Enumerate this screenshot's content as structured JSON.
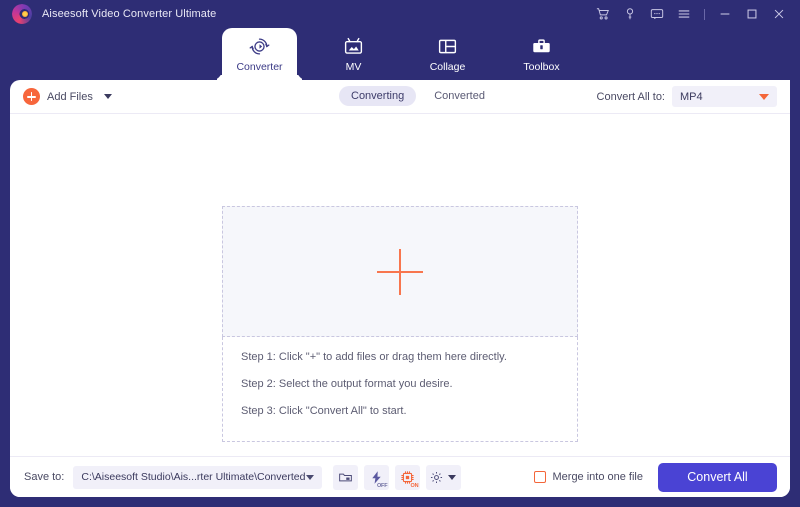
{
  "window": {
    "title": "Aiseesoft Video Converter Ultimate",
    "logo_icon": "aiseesoft-logo-icon",
    "controls": [
      {
        "name": "cart-icon",
        "label": "Cart"
      },
      {
        "name": "key-icon",
        "label": "Register"
      },
      {
        "name": "feedback-icon",
        "label": "Feedback"
      },
      {
        "name": "menu-icon",
        "label": "Menu"
      },
      {
        "name": "minimize-icon",
        "label": "Minimize"
      },
      {
        "name": "maximize-icon",
        "label": "Maximize"
      },
      {
        "name": "close-icon",
        "label": "Close"
      }
    ],
    "accent_header": "#2e2d75",
    "accent_button": "#4a43d4",
    "accent_orange": "#f4663a"
  },
  "tabs": [
    {
      "label": "Converter",
      "icon": "converter-icon",
      "active": true
    },
    {
      "label": "MV",
      "icon": "mv-icon",
      "active": false
    },
    {
      "label": "Collage",
      "icon": "collage-icon",
      "active": false
    },
    {
      "label": "Toolbox",
      "icon": "toolbox-icon",
      "active": false
    }
  ],
  "toolbar": {
    "add_files_label": "Add Files",
    "add_files_icon": "plus-circle-icon",
    "add_files_caret": "chevron-down-icon",
    "segments": [
      {
        "label": "Converting",
        "selected": true
      },
      {
        "label": "Converted",
        "selected": false
      }
    ],
    "convert_all_to_label": "Convert All to:",
    "format_value": "MP4",
    "format_caret": "caret-down-icon"
  },
  "dropzone": {
    "plus_icon": "plus-icon",
    "steps": [
      "Step 1: Click \"+\" to add files or drag them here directly.",
      "Step 2: Select the output format you desire.",
      "Step 3: Click \"Convert All\" to start."
    ]
  },
  "footer": {
    "save_to_label": "Save to:",
    "save_path": "C:\\Aiseesoft Studio\\Ais...rter Ultimate\\Converted",
    "path_caret": "caret-down-icon",
    "utilities": [
      {
        "name": "open-folder-icon",
        "tag": ""
      },
      {
        "name": "hardware-acceleration-icon",
        "tag": "OFF"
      },
      {
        "name": "gpu-chip-icon",
        "tag": "ON"
      },
      {
        "name": "preferences-gear-icon",
        "tag": ""
      }
    ],
    "merge_label": "Merge into one file",
    "merge_checked": false,
    "convert_all_label": "Convert All"
  }
}
